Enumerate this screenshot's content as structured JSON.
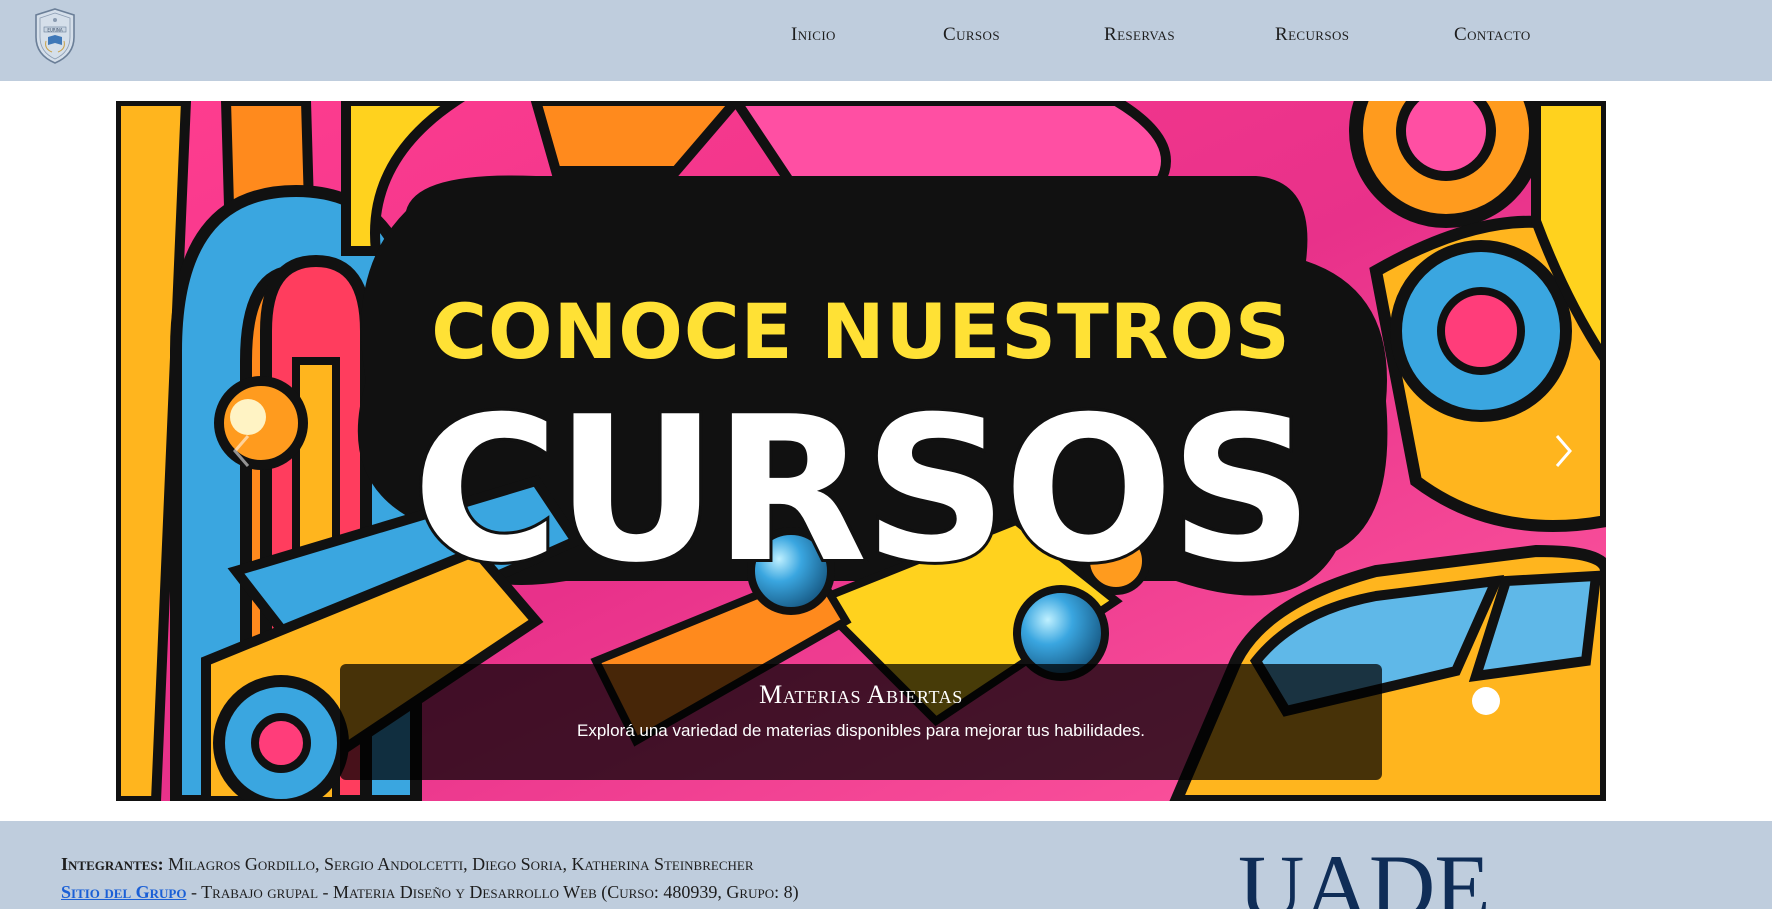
{
  "header": {
    "logo_icon": "university-crest-icon",
    "logo_text": "EURINA",
    "nav": [
      "Inicio",
      "Cursos",
      "Reservas",
      "Recursos",
      "Contacto"
    ]
  },
  "carousel": {
    "slide_headline_top": "CONOCE NUESTROS",
    "slide_headline_main": "CURSOS",
    "caption_title": "Materias Abiertas",
    "caption_text": "Explorá una variedad de materias disponibles para mejorar tus habilidades.",
    "prev_icon": "chevron-left-icon",
    "next_icon": "chevron-right-icon"
  },
  "footer": {
    "members_label": "Integrantes:",
    "members": "Milagros Gordillo, Sergio Andolcetti, Diego Soria, Katherina Steinbrecher",
    "group_link": "Sitio del Grupo",
    "group_info": " - Trabajo grupal - Materia Diseño y Desarrollo Web (Curso: 480939, Grupo: 8)",
    "brand": "UADE"
  },
  "colors": {
    "header_bg": "#bfcddd",
    "footer_bg": "#bfcddd",
    "link": "#1a5fd6",
    "brand": "#0f2d57"
  }
}
